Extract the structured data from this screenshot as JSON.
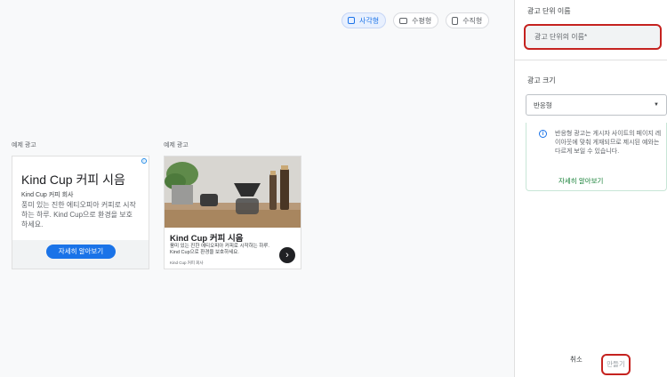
{
  "format_toggles": [
    {
      "label": "사각형",
      "icon": "square-icon",
      "active": true
    },
    {
      "label": "수평형",
      "icon": "horizontal-rect-icon",
      "active": false
    },
    {
      "label": "수직형",
      "icon": "vertical-rect-icon",
      "active": false
    }
  ],
  "examples": {
    "label_1": "예제 광고",
    "label_2": "예제 광고",
    "ad1": {
      "title": "Kind Cup 커피 시음",
      "company": "Kind Cup 커피 회사",
      "description": "풍미 있는 진한 에티오피아 커피로 시작하는 하루. Kind Cup으로 환경을 보호하세요.",
      "cta": "자세히 알아보기"
    },
    "ad2": {
      "title": "Kind Cup 커피 시음",
      "description": "풍미 있는 진한 에티오피아 커피로 시작하는 하루. Kind Cup으로 환경을 보호하세요.",
      "company": "Kind Cup 커피 회사",
      "arrow": "›"
    }
  },
  "panel": {
    "name_section_title": "광고 단위 이름",
    "name_placeholder": "광고 단위의 이름*",
    "size_section_title": "광고 크기",
    "size_value": "반응형",
    "info_text": "반응형 광고는 게시자 사이트의 페이지 레이아웃에 맞춰 게재되므로 제시된 예와는 다르게 보일 수 있습니다.",
    "info_link": "자세히 알아보기",
    "cancel": "취소",
    "create": "만들기"
  },
  "colors": {
    "accent": "#1a73e8",
    "highlight": "#c5221f",
    "link_green": "#188038"
  }
}
